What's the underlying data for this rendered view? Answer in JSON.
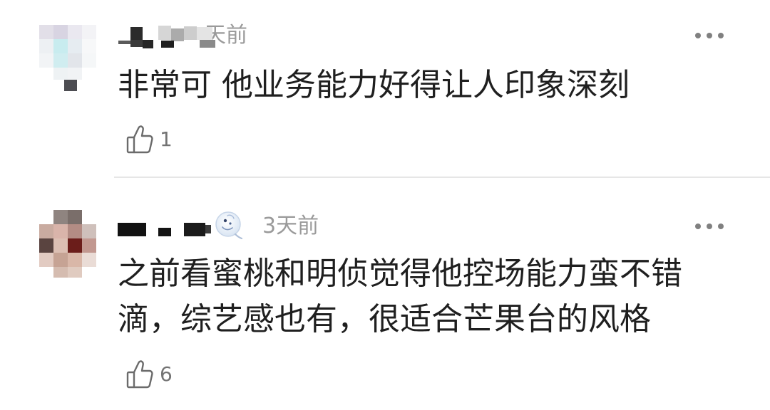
{
  "comments": [
    {
      "time": "天前",
      "text_lines": [
        "非常可 他业务能力好得让人印象深刻"
      ],
      "like_count": "1"
    },
    {
      "time": "3天前",
      "text_lines": [
        "之前看蜜桃和明侦觉得他控场能力蛮不错",
        "滴，综艺感也有，很适合芒果台的风格"
      ],
      "like_count": "6"
    }
  ],
  "icons": {
    "like": "thumbs-up-icon",
    "more": "more-options-icon",
    "badge": "user-badge-icon"
  },
  "colors": {
    "background": "#ffffff",
    "text_primary": "#1f1f1f",
    "text_secondary": "#9a9a9a",
    "icon": "#6b6b6b",
    "divider": "#e6e6e6"
  }
}
